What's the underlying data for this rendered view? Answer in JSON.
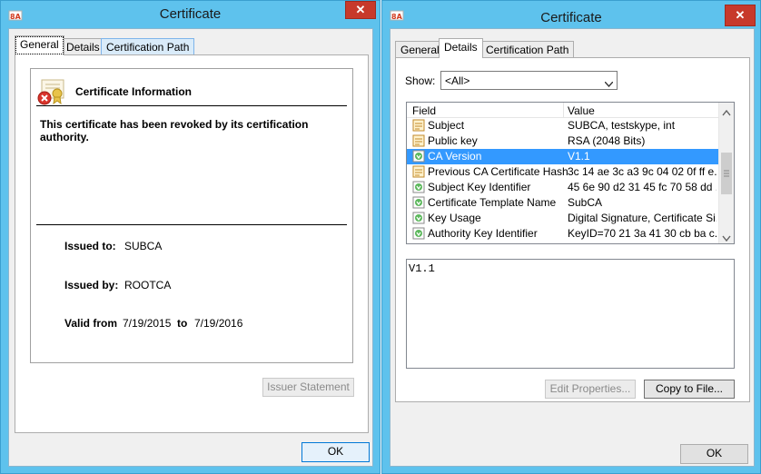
{
  "left_window": {
    "title": "Certificate",
    "close_label": "✕",
    "tabs": [
      "General",
      "Details",
      "Certification Path"
    ],
    "info_heading": "Certificate Information",
    "revoked_message": "This certificate has been revoked by its certification authority.",
    "issued_to_label": "Issued to:",
    "issued_to_value": "SUBCA",
    "issued_by_label": "Issued by:",
    "issued_by_value": "ROOTCA",
    "valid_from_label": "Valid from",
    "valid_from_value": "7/19/2015",
    "valid_to_label": "to",
    "valid_to_value": "7/19/2016",
    "issuer_statement_label": "Issuer Statement",
    "ok_label": "OK"
  },
  "right_window": {
    "title": "Certificate",
    "close_label": "✕",
    "tabs": [
      "General",
      "Details",
      "Certification Path"
    ],
    "show_label": "Show:",
    "show_value": "<All>",
    "columns": {
      "field": "Field",
      "value": "Value"
    },
    "rows": [
      {
        "field": "Subject",
        "value": "SUBCA, testskype, int",
        "icon": "certificate-field-icon"
      },
      {
        "field": "Public key",
        "value": "RSA (2048 Bits)",
        "icon": "certificate-field-icon"
      },
      {
        "field": "CA Version",
        "value": "V1.1",
        "icon": "extension-field-icon"
      },
      {
        "field": "Previous CA Certificate Hash",
        "value": "3c 14 ae 3c a3 9c 04 02 0f ff e...",
        "icon": "certificate-field-icon"
      },
      {
        "field": "Subject Key Identifier",
        "value": "45 6e 90 d2 31 45 fc 70 58 dd ...",
        "icon": "extension-field-icon"
      },
      {
        "field": "Certificate Template Name",
        "value": "SubCA",
        "icon": "extension-field-icon"
      },
      {
        "field": "Key Usage",
        "value": "Digital Signature, Certificate Si...",
        "icon": "extension-field-icon"
      },
      {
        "field": "Authority Key Identifier",
        "value": "KeyID=70 21 3a 41 30 cb ba c...",
        "icon": "extension-field-icon"
      }
    ],
    "selected_row": 2,
    "detail_text": "V1.1",
    "edit_properties_label": "Edit Properties...",
    "copy_to_file_label": "Copy to File...",
    "ok_label": "OK"
  }
}
